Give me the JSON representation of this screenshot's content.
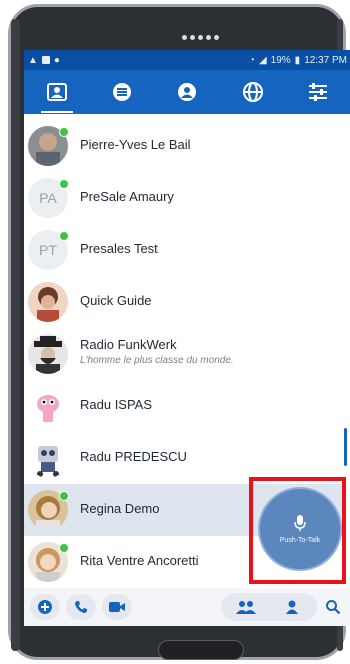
{
  "status": {
    "battery_text": "19%",
    "time": "12:37 PM"
  },
  "nav": [
    {
      "id": "contacts",
      "icon": "contact-card-icon",
      "active": true
    },
    {
      "id": "conversations",
      "icon": "chat-list-icon",
      "active": false
    },
    {
      "id": "bubbles",
      "icon": "bubble-group-icon",
      "active": false
    },
    {
      "id": "network",
      "icon": "globe-icon",
      "active": false
    },
    {
      "id": "settings",
      "icon": "sliders-icon",
      "active": false
    }
  ],
  "contacts": [
    {
      "name": "Pierre-Yves Le Bail",
      "subtitle": "",
      "online": true,
      "initials": ""
    },
    {
      "name": "PreSale Amaury",
      "subtitle": "",
      "online": true,
      "initials": "PA"
    },
    {
      "name": "Presales Test",
      "subtitle": "",
      "online": true,
      "initials": "PT"
    },
    {
      "name": "Quick Guide",
      "subtitle": "",
      "online": false,
      "initials": ""
    },
    {
      "name": "Radio FunkWerk",
      "subtitle": "L'homme le plus classe du monde.",
      "online": false,
      "initials": ""
    },
    {
      "name": "Radu ISPAS",
      "subtitle": "",
      "online": false,
      "initials": ""
    },
    {
      "name": "Radu PREDESCU",
      "subtitle": "",
      "online": false,
      "initials": ""
    },
    {
      "name": "Regina Demo",
      "subtitle": "",
      "online": true,
      "initials": ""
    },
    {
      "name": "Rita Ventre Ancoretti",
      "subtitle": "",
      "online": true,
      "initials": ""
    }
  ],
  "ptt": {
    "label": "Push-To-Talk"
  },
  "bottom": {
    "left": [
      "add-chat-icon",
      "phone-icon",
      "video-icon"
    ],
    "right": [
      "group-icon",
      "person-icon",
      "search-icon"
    ]
  },
  "colors": {
    "primary": "#1565c0",
    "online": "#3ec43e",
    "highlight": "#e8121d"
  }
}
